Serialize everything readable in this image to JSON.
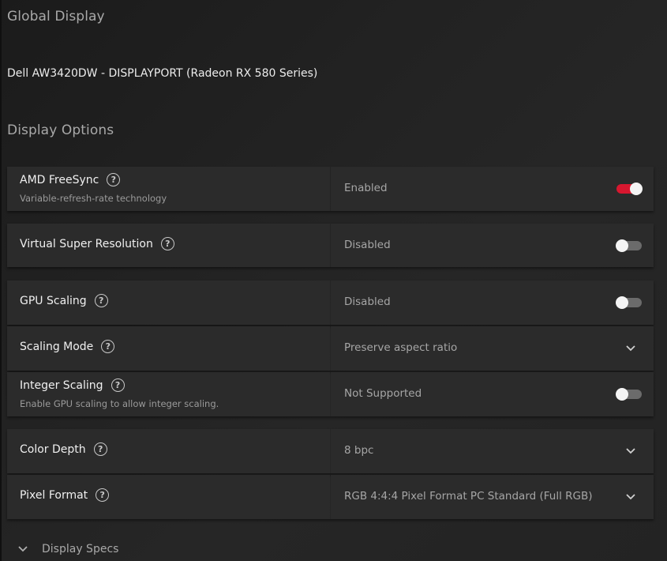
{
  "global_display": {
    "title": "Global Display",
    "monitor": "Dell AW3420DW - DISPLAYPORT (Radeon RX 580 Series)"
  },
  "display_options": {
    "title": "Display Options",
    "freesync": {
      "label": "AMD FreeSync",
      "description": "Variable-refresh-rate technology",
      "value": "Enabled",
      "enabled": true
    },
    "vsr": {
      "label": "Virtual Super Resolution",
      "value": "Disabled",
      "enabled": false
    },
    "gpu_scaling": {
      "label": "GPU Scaling",
      "value": "Disabled",
      "enabled": false
    },
    "scaling_mode": {
      "label": "Scaling Mode",
      "value": "Preserve aspect ratio"
    },
    "integer_scaling": {
      "label": "Integer Scaling",
      "description": "Enable GPU scaling to allow integer scaling.",
      "value": "Not Supported",
      "enabled": false
    },
    "color_depth": {
      "label": "Color Depth",
      "value": "8 bpc"
    },
    "pixel_format": {
      "label": "Pixel Format",
      "value": "RGB 4:4:4 Pixel Format PC Standard (Full RGB)"
    },
    "help_glyph": "?",
    "toggle_on_color": "#d7172f",
    "toggle_off_color": "#6b6b6b"
  },
  "display_specs": {
    "label": "Display Specs"
  }
}
